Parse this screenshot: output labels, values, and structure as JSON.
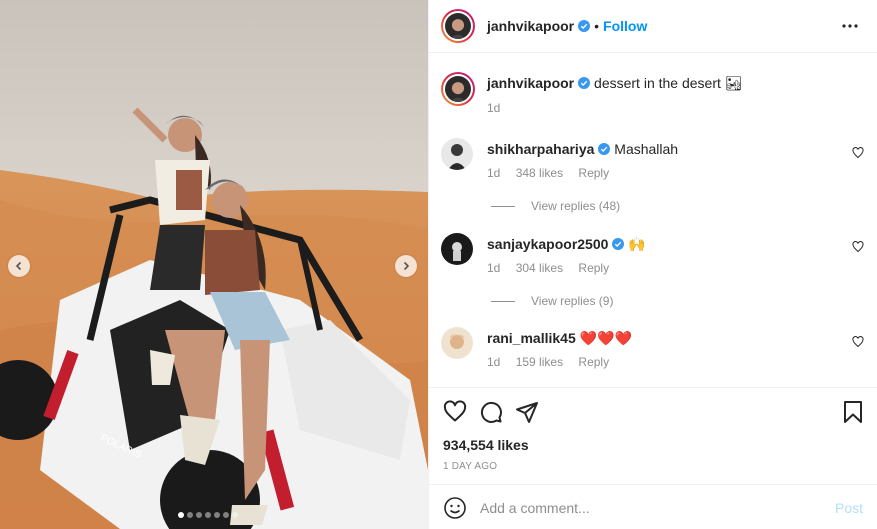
{
  "post_author": {
    "username": "janhvikapoor",
    "follow_label": "Follow",
    "separator": "•"
  },
  "caption": {
    "username": "janhvikapoor",
    "text": "dessert in the desert 🏜",
    "time": "1d"
  },
  "comments": [
    {
      "username": "shikharpahariya",
      "verified": true,
      "text": "Mashallah",
      "time": "1d",
      "likes": "348 likes",
      "reply_label": "Reply",
      "view_replies": "View replies (48)"
    },
    {
      "username": "sanjaykapoor2500",
      "verified": true,
      "text": "🙌",
      "time": "1d",
      "likes": "304 likes",
      "reply_label": "Reply",
      "view_replies": "View replies (9)"
    },
    {
      "username": "rani_mallik45",
      "verified": false,
      "text": "❤️❤️❤️",
      "time": "1d",
      "likes": "159 likes",
      "reply_label": "Reply"
    }
  ],
  "stats": {
    "likes": "934,554 likes",
    "posted": "1 DAY AGO"
  },
  "comment_box": {
    "placeholder": "Add a comment...",
    "post_label": "Post"
  },
  "carousel": {
    "total": 7,
    "active_index": 0
  },
  "colors": {
    "accent": "#0095f6",
    "verified": "#3897f0",
    "text": "#262626",
    "muted": "#8e8e8e",
    "post_disabled": "#b2dffc"
  },
  "icons": [
    "chevron-left-icon",
    "chevron-right-icon",
    "more-icon",
    "verified-icon",
    "heart-icon",
    "comment-icon",
    "share-icon",
    "bookmark-icon",
    "emoji-icon"
  ]
}
